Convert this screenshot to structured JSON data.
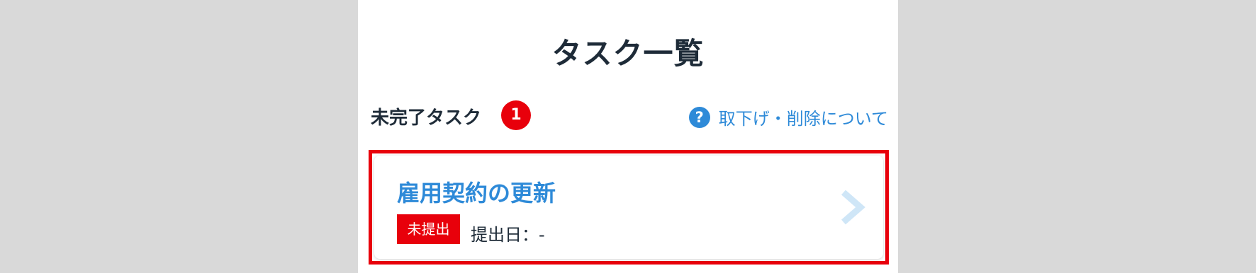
{
  "page": {
    "title": "タスク一覧"
  },
  "section": {
    "title": "未完了タスク",
    "count": "1",
    "help_link_label": "取下げ・削除について",
    "help_icon_glyph": "?"
  },
  "tasks": [
    {
      "title": "雇用契約の更新",
      "status": "未提出",
      "submit_date": "提出日：-"
    }
  ],
  "colors": {
    "accent_blue": "#2e8ad8",
    "alert_red": "#e8000b",
    "text_dark": "#1e2b38",
    "chevron": "#cfe6f7"
  },
  "icons": {
    "help": "question-circle-icon",
    "chevron": "chevron-right-icon"
  }
}
